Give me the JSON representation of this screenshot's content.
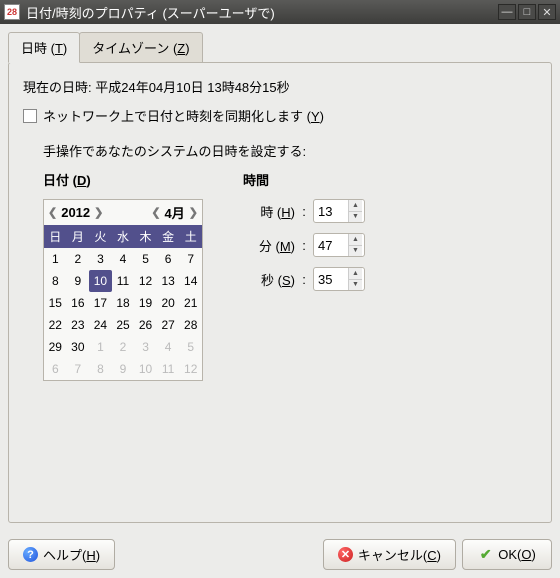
{
  "titlebar": {
    "icon_text": "28",
    "title": "日付/時刻のプロパティ (スーパーユーザで)"
  },
  "tabs": {
    "datetime": "日時 (T)",
    "timezone": "タイムゾーン (Z)"
  },
  "panel": {
    "current_label": "現在の日時:",
    "current_value": "平成24年04月10日  13時48分15秒",
    "sync_label": "ネットワーク上で日付と時刻を同期化します (Y)",
    "manual_label": "手操作であなたのシステムの日時を設定する:",
    "date_heading": "日付 (D)",
    "time_heading": "時間"
  },
  "calendar": {
    "year": "2012",
    "month": "4月",
    "weekdays": [
      "日",
      "月",
      "火",
      "水",
      "木",
      "金",
      "土"
    ],
    "cells": [
      {
        "d": "1"
      },
      {
        "d": "2"
      },
      {
        "d": "3"
      },
      {
        "d": "4"
      },
      {
        "d": "5"
      },
      {
        "d": "6"
      },
      {
        "d": "7"
      },
      {
        "d": "8"
      },
      {
        "d": "9"
      },
      {
        "d": "10",
        "today": true
      },
      {
        "d": "11"
      },
      {
        "d": "12"
      },
      {
        "d": "13"
      },
      {
        "d": "14"
      },
      {
        "d": "15"
      },
      {
        "d": "16"
      },
      {
        "d": "17"
      },
      {
        "d": "18"
      },
      {
        "d": "19"
      },
      {
        "d": "20"
      },
      {
        "d": "21"
      },
      {
        "d": "22"
      },
      {
        "d": "23"
      },
      {
        "d": "24"
      },
      {
        "d": "25"
      },
      {
        "d": "26"
      },
      {
        "d": "27"
      },
      {
        "d": "28"
      },
      {
        "d": "29"
      },
      {
        "d": "30"
      },
      {
        "d": "1",
        "other": true
      },
      {
        "d": "2",
        "other": true
      },
      {
        "d": "3",
        "other": true
      },
      {
        "d": "4",
        "other": true
      },
      {
        "d": "5",
        "other": true
      },
      {
        "d": "6",
        "other": true
      },
      {
        "d": "7",
        "other": true
      },
      {
        "d": "8",
        "other": true
      },
      {
        "d": "9",
        "other": true
      },
      {
        "d": "10",
        "other": true
      },
      {
        "d": "11",
        "other": true
      },
      {
        "d": "12",
        "other": true
      }
    ]
  },
  "time": {
    "hour_label": "時 (H)",
    "min_label": "分 (M)",
    "sec_label": "秒 (S)",
    "hour": "13",
    "minute": "47",
    "second": "35"
  },
  "buttons": {
    "help": "ヘルプ(H)",
    "cancel": "キャンセル(C)",
    "ok": "OK(O)"
  }
}
